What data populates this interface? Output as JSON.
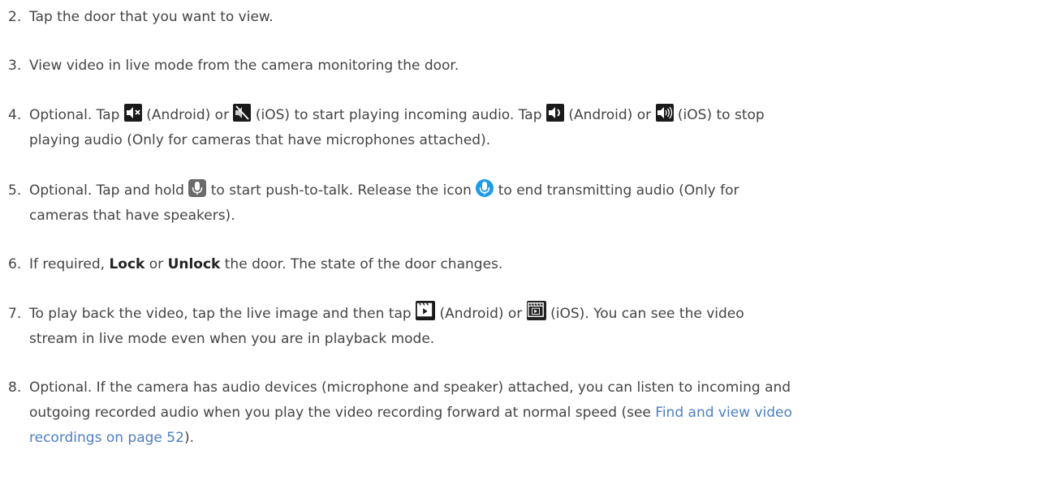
{
  "steps": [
    {
      "num": "2.",
      "text": "Tap the door that you want to view."
    },
    {
      "num": "3.",
      "text": "View video in live mode from the camera monitoring the door."
    },
    {
      "num": "4.",
      "t1": "Optional. Tap",
      "t2": "(Android) or",
      "t3": "(iOS) to start playing incoming audio. Tap",
      "t4": "(Android) or",
      "t5": "(iOS) to stop",
      "t6": "playing audio (Only for cameras that have microphones attached).",
      "icons": [
        "speaker-mute-android-icon",
        "speaker-mute-ios-icon",
        "speaker-on-android-icon",
        "speaker-on-ios-icon"
      ]
    },
    {
      "num": "5.",
      "t1": "Optional. Tap and hold",
      "t2": "to start push-to-talk. Release the icon",
      "t3": "to end transmitting audio (Only for",
      "t4": "cameras that have speakers).",
      "icons": [
        "microphone-icon",
        "microphone-active-icon"
      ]
    },
    {
      "num": "6.",
      "t1": "If required,",
      "b1": "Lock",
      "t2": "or",
      "b2": "Unlock",
      "t3": "the door. The state of the door changes."
    },
    {
      "num": "7.",
      "t1": "To play back the video, tap the live image and then tap",
      "t2": "(Android) or",
      "t3": "(iOS). You can see the video",
      "t4": "stream in live mode even when you are in playback mode.",
      "icons": [
        "playback-android-icon",
        "playback-ios-icon"
      ]
    },
    {
      "num": "8.",
      "t1": "Optional. If the camera has audio devices (microphone and speaker) attached, you can listen to incoming and",
      "t2": "outgoing recorded audio when you play the video recording forward at normal speed (see",
      "link1": "Find and view video",
      "link2": "recordings on page 52",
      "t3": ")."
    }
  ],
  "colors": {
    "text": "#444444",
    "link": "#4d7ec2",
    "mic_active": "#1e9be6"
  }
}
